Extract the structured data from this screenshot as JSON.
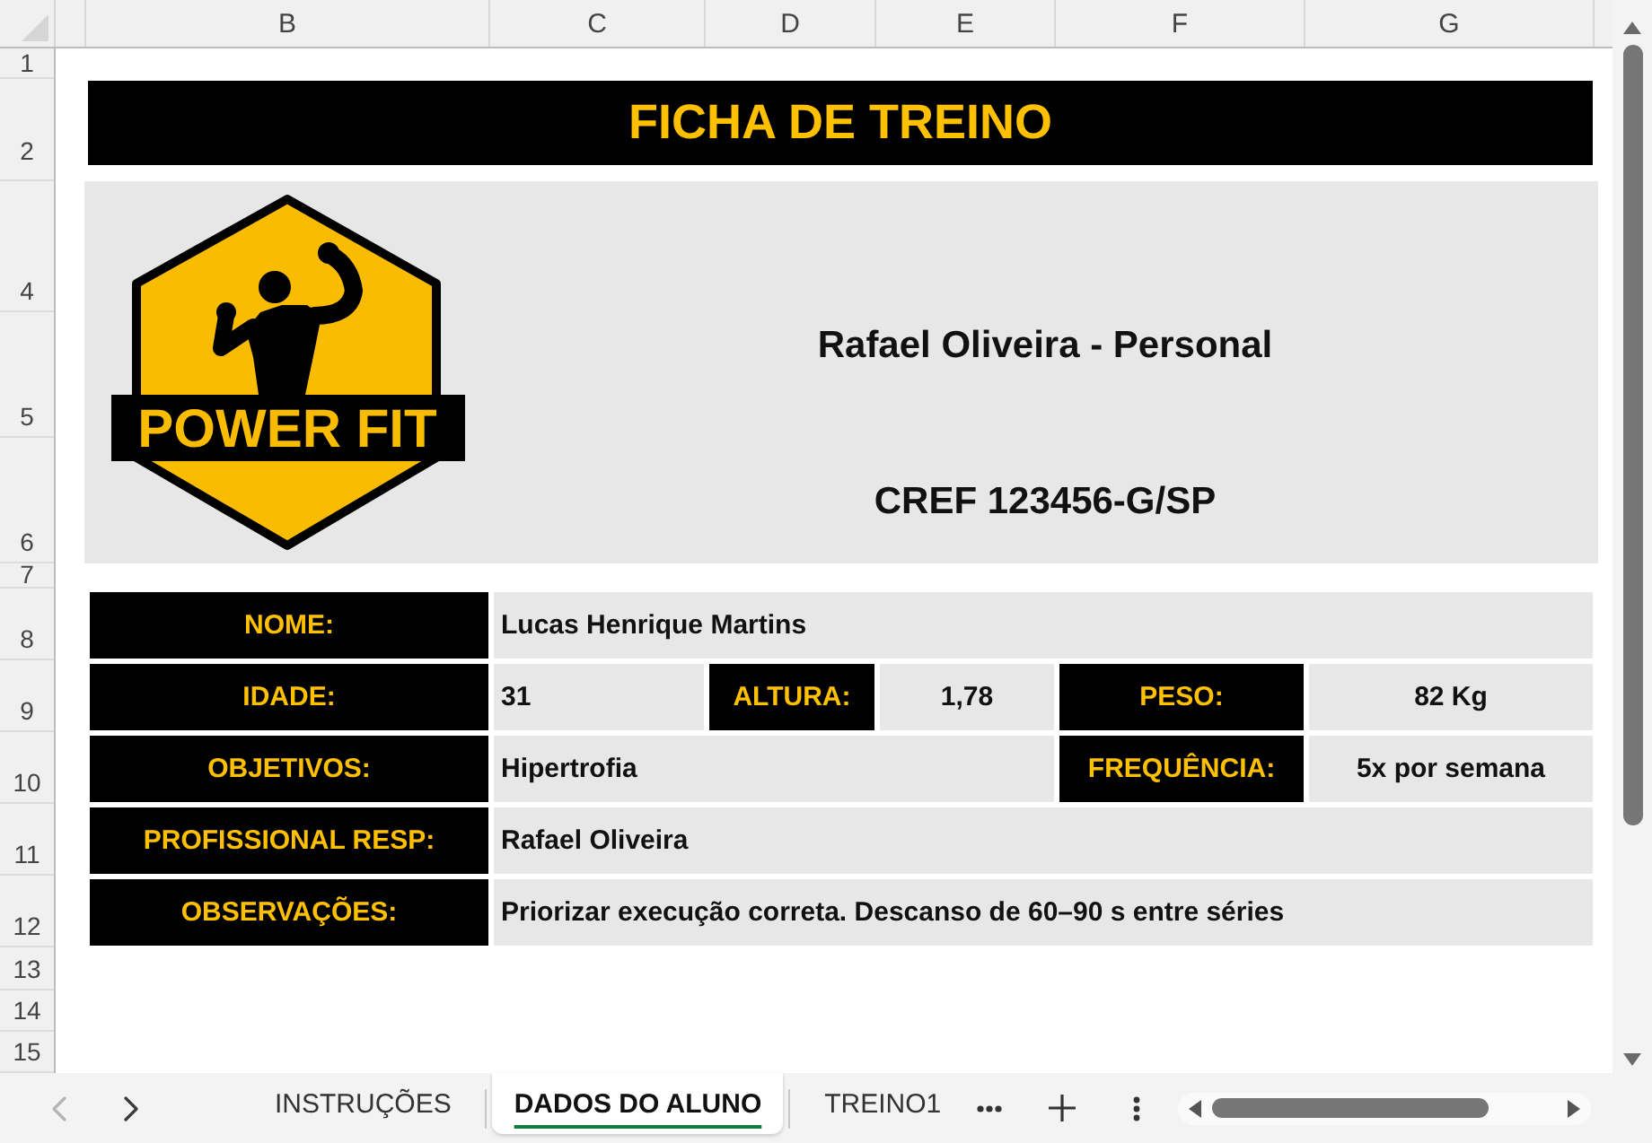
{
  "sheet": {
    "column_headers": [
      "B",
      "C",
      "D",
      "E",
      "F",
      "G"
    ],
    "row_numbers": [
      "1",
      "2",
      "4",
      "5",
      "6",
      "7",
      "8",
      "9",
      "10",
      "11",
      "12",
      "13",
      "14",
      "15"
    ]
  },
  "title": "FICHA DE TREINO",
  "header_panel": {
    "logo_text": "POWER FIT",
    "trainer": "Rafael Oliveira - Personal",
    "registration": "CREF 123456-G/SP"
  },
  "form": [
    {
      "kind": "single",
      "fields": [
        {
          "label": "NOME:",
          "value": "Lucas Henrique Martins"
        }
      ]
    },
    {
      "kind": "triple",
      "fields": [
        {
          "label": "IDADE:",
          "value": "31"
        },
        {
          "label": "ALTURA:",
          "value": "1,78"
        },
        {
          "label": "PESO:",
          "value": "82 Kg"
        }
      ]
    },
    {
      "kind": "double",
      "fields": [
        {
          "label": "OBJETIVOS:",
          "value": "Hipertrofia"
        },
        {
          "label": "FREQUÊNCIA:",
          "value": "5x por semana"
        }
      ]
    },
    {
      "kind": "single",
      "fields": [
        {
          "label": "PROFISSIONAL RESP:",
          "value": "Rafael Oliveira"
        }
      ]
    },
    {
      "kind": "single",
      "fields": [
        {
          "label": "OBSERVAÇÕES:",
          "value": "Priorizar execução correta. Descanso de 60–90 s entre séries"
        }
      ]
    }
  ],
  "sheet_nav": [
    {
      "kind": "previous",
      "disabled": true
    },
    {
      "kind": "next",
      "disabled": false
    }
  ],
  "sheet_tabs": [
    {
      "label": "INSTRUÇÕES",
      "selected": false
    },
    {
      "label": "DADOS DO ALUNO",
      "selected": true
    },
    {
      "label": "TREINO1",
      "selected": false
    }
  ]
}
